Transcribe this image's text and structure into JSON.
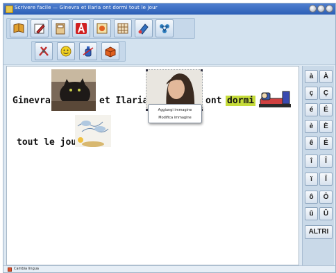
{
  "window": {
    "title": "Scrivere facile — Ginevra et Ilaria ont dormi tout le jour",
    "controls": [
      "minimize-icon",
      "maximize-icon",
      "close-icon"
    ]
  },
  "toolbar": {
    "row1": [
      {
        "name": "book-button",
        "icon": "book-icon",
        "color": "#e0a030"
      },
      {
        "name": "pencil-button",
        "icon": "pencil-icon",
        "color": "#d03030"
      },
      {
        "name": "notebook-button",
        "icon": "notebook-icon",
        "color": "#b08040"
      },
      {
        "name": "text-a-button",
        "icon": "letter-a-icon",
        "color": "#d02020"
      },
      {
        "name": "picture-button",
        "icon": "picture-icon",
        "color": "#e06020"
      },
      {
        "name": "grid-button",
        "icon": "grid-icon",
        "color": "#c09050"
      },
      {
        "name": "paint-button",
        "icon": "paint-icon",
        "color": "#3070c0"
      },
      {
        "name": "network-button",
        "icon": "network-icon",
        "color": "#3080c0"
      }
    ],
    "row2": [
      {
        "name": "tools-button",
        "icon": "tools-icon",
        "color": "#c03030"
      },
      {
        "name": "smiley-button",
        "icon": "smiley-icon",
        "color": "#e8c020"
      },
      {
        "name": "bottle-button",
        "icon": "bottle-icon",
        "color": "#3060c0"
      },
      {
        "name": "box-button",
        "icon": "box-icon",
        "color": "#e06020"
      }
    ]
  },
  "document": {
    "line1": [
      "Ginevra",
      "et Ilaria",
      "ont",
      "dormi"
    ],
    "line2": [
      "tout le jour"
    ],
    "highlight_color": "#c6dc3a",
    "images": [
      "cat-photo",
      "girl-photo",
      "sleeping-figure",
      "sky-drawing"
    ]
  },
  "context_menu": {
    "items": [
      "Aggiungi immagine",
      "Modifica immagine"
    ]
  },
  "accent_keys": [
    [
      "à",
      "À"
    ],
    [
      "ç",
      "Ç"
    ],
    [
      "é",
      "É"
    ],
    [
      "è",
      "È"
    ],
    [
      "ê",
      "Ê"
    ],
    [
      "î",
      "Î"
    ],
    [
      "ï",
      "Ï"
    ],
    [
      "ô",
      "Ô"
    ],
    [
      "û",
      "Û"
    ]
  ],
  "altri_label": "ALTRI",
  "statusbar": {
    "label": "Cambia lingua"
  }
}
